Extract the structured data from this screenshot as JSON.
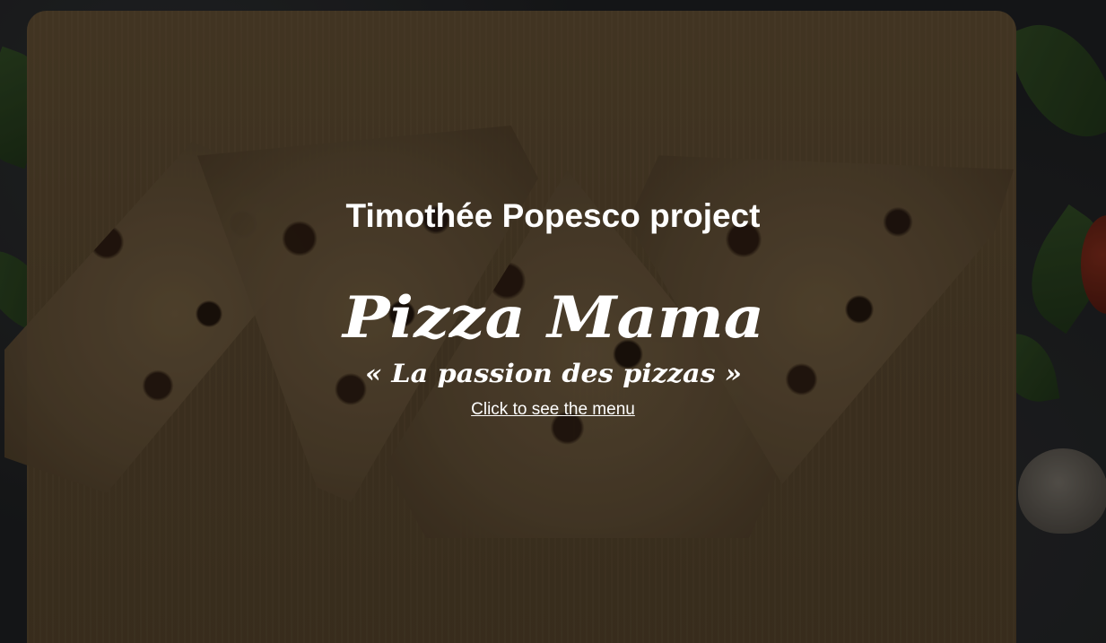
{
  "hero": {
    "title": "Timothée Popesco project",
    "logo": {
      "wordmark": "Pizza Mama",
      "tagline": "« La passion des pizzas »"
    },
    "menu_link": "Click to see the menu"
  }
}
